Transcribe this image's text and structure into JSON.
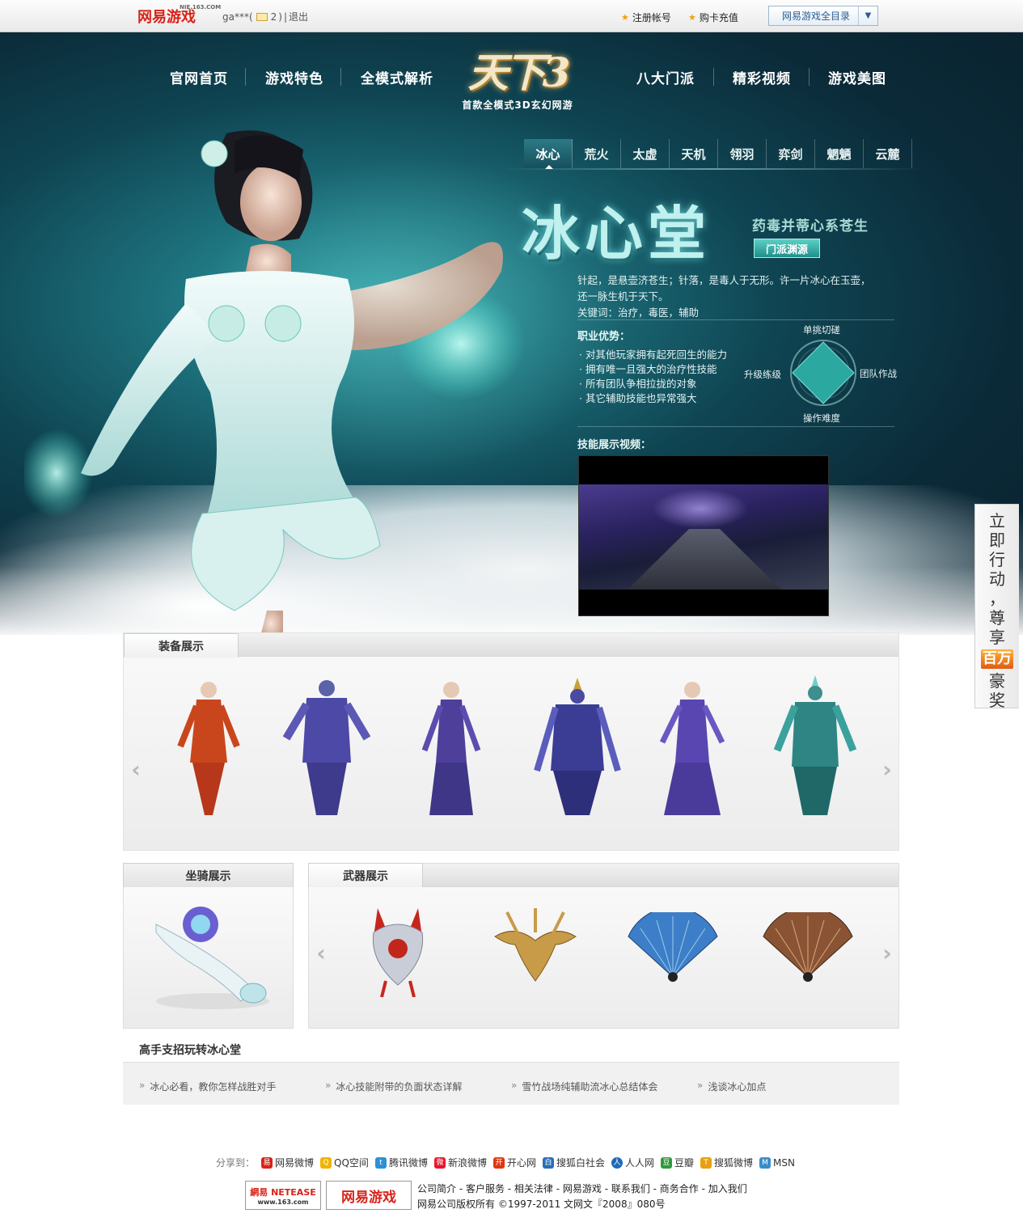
{
  "topbar": {
    "logo": "网易游戏",
    "logo_small": "NIE.163.COM",
    "user_name": "ga***(",
    "mail_count": "2",
    "user_close": ")",
    "sep": "|",
    "logout": "退出",
    "register": "注册帐号",
    "recharge": "购卡充值",
    "directory": "网易游戏全目录"
  },
  "nav": {
    "items": [
      "官网首页",
      "游戏特色",
      "全模式解析",
      "八大门派",
      "精彩视频",
      "游戏美图"
    ],
    "logo_text": "天下3",
    "logo_sub": "首款全模式3D玄幻网游"
  },
  "tabs": [
    "冰心",
    "荒火",
    "太虚",
    "天机",
    "翎羽",
    "弈剑",
    "魍魉",
    "云麓"
  ],
  "sect": {
    "title": "冰心堂",
    "slogan": "药毒并蒂心系苍生",
    "origin_button": "门派渊源",
    "intro_1": "针起，是悬壶济苍生；针落，是毒人于无形。许一片冰心在玉壶，",
    "intro_2": "还一脉生机于天下。",
    "keywords": "关键词：治疗，毒医，辅助",
    "advantage_title": "职业优势：",
    "advantages": [
      "对其他玩家拥有起死回生的能力",
      "拥有唯一且强大的治疗性技能",
      "所有团队争相拉拢的对象",
      "其它辅助技能也异常强大"
    ],
    "radar_labels": {
      "top": "单挑切磋",
      "right": "团队作战",
      "bottom": "操作难度",
      "left": "升级练级"
    },
    "video_title": "技能展示视频："
  },
  "panels": {
    "equip_title": "装备展示",
    "mount_title": "坐骑展示",
    "weapon_title": "武器展示"
  },
  "tips": {
    "title": "高手支招玩转冰心堂",
    "items": [
      "冰心必看，教你怎样战胜对手",
      "冰心技能附带的负面状态详解",
      "雪竹战场纯辅助流冰心总结体会",
      "浅谈冰心加点"
    ]
  },
  "side_ad": {
    "chars": [
      "立",
      "即",
      "行",
      "动",
      "，",
      "尊",
      "享"
    ],
    "hot": "百万",
    "chars2": [
      "豪",
      "奖"
    ]
  },
  "share": {
    "label": "分享到：",
    "items": [
      "网易微博",
      "QQ空间",
      "腾讯微博",
      "新浪微博",
      "开心网",
      "搜狐白社会",
      "人人网",
      "豆瓣",
      "搜狐微博",
      "MSN"
    ]
  },
  "footer": {
    "netease_logo": "網易 NETEASE",
    "netease_url": "www.163.com",
    "game_logo": "网易游戏",
    "links": "公司简介 - 客户服务 - 相关法律 - 网易游戏 - 联系我们 - 商务合作 - 加入我们",
    "copyright": "网易公司版权所有 ©1997-2011    文网文『2008』080号"
  },
  "colors": {
    "accent_teal": "#2c7a86",
    "netease_red": "#d8231a"
  }
}
